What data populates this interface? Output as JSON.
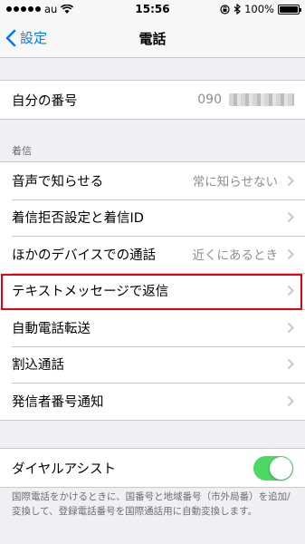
{
  "status_bar": {
    "carrier": "au",
    "time": "15:56",
    "battery": "100%"
  },
  "nav": {
    "back_label": "設定",
    "title": "電話"
  },
  "my_number": {
    "label": "自分の番号",
    "value": "090"
  },
  "incoming": {
    "header": "着信",
    "items": [
      {
        "label": "音声で知らせる",
        "value": "常に知らせない"
      },
      {
        "label": "着信拒否設定と着信ID",
        "value": ""
      },
      {
        "label": "ほかのデバイスでの通話",
        "value": "近くにあるとき"
      },
      {
        "label": "テキストメッセージで返信",
        "value": ""
      },
      {
        "label": "自動電話転送",
        "value": ""
      },
      {
        "label": "割込通話",
        "value": ""
      },
      {
        "label": "発信者番号通知",
        "value": ""
      }
    ]
  },
  "dial_assist": {
    "label": "ダイヤルアシスト",
    "enabled": true,
    "toggle_color": "#4cd964",
    "footer": "国際電話をかけるときに、国番号と地域番号（市外局番）を追加/変換して、登録電話番号を国際通話用に自動変換します。"
  },
  "colors": {
    "accent": "#007aff",
    "highlight_border": "#e60012"
  }
}
